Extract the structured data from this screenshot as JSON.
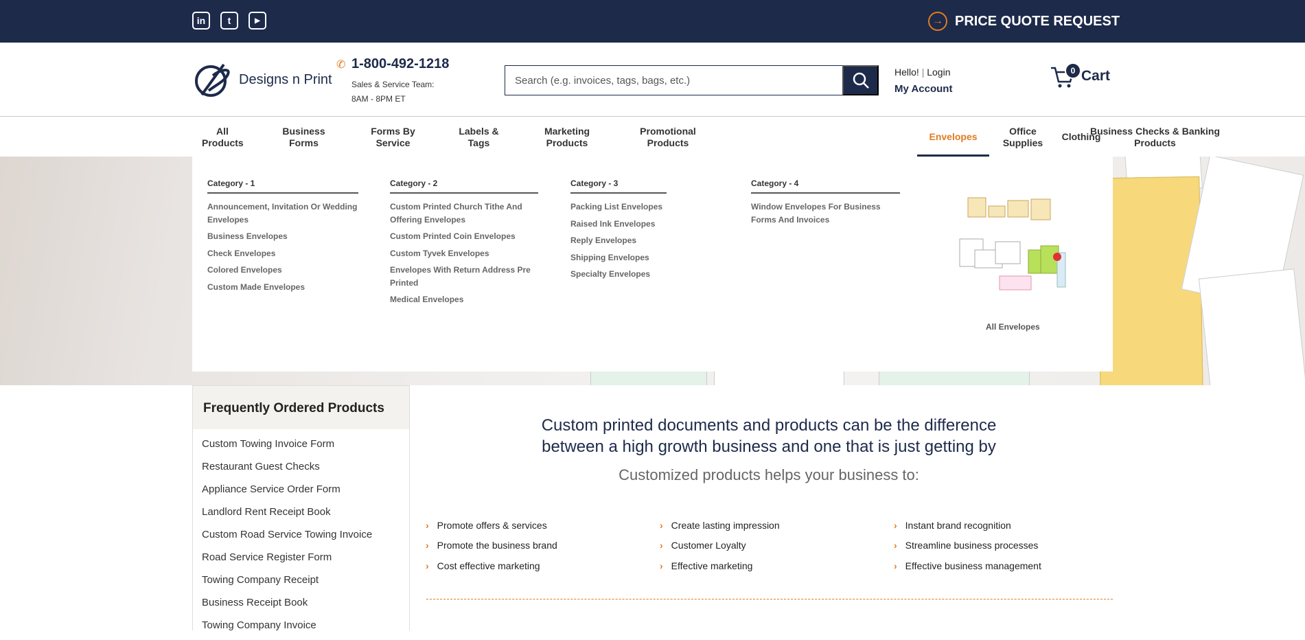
{
  "topbar": {
    "social": [
      "in",
      "t",
      "▶"
    ],
    "quote_label": "PRICE QUOTE REQUEST"
  },
  "header": {
    "logo_text": "Designs n Print",
    "phone": "1-800-492-1218",
    "phone_line1": "Sales & Service Team:",
    "phone_line2": "8AM - 8PM ET",
    "search_placeholder": "Search (e.g. invoices, tags, bags, etc.)",
    "greeting": "Hello!",
    "login": "Login",
    "my_account": "My Account",
    "cart_count": "0",
    "cart_label": "Cart"
  },
  "nav": [
    {
      "line1": "All",
      "line2": "Products"
    },
    {
      "line1": "Business",
      "line2": "Forms"
    },
    {
      "line1": "Forms By",
      "line2": "Service"
    },
    {
      "line1": "Labels &",
      "line2": "Tags"
    },
    {
      "line1": "Marketing",
      "line2": "Products"
    },
    {
      "line1": "Promotional",
      "line2": "Products"
    },
    {
      "line1": "Envelopes",
      "line2": ""
    },
    {
      "line1": "Office",
      "line2": "Supplies"
    },
    {
      "line1": "Business Checks & Banking",
      "line2": "Products"
    },
    {
      "line1": "Clothing",
      "line2": ""
    }
  ],
  "mega_menu": {
    "categories": [
      {
        "title": "Category - 1",
        "items": [
          "Announcement, Invitation Or Wedding Envelopes",
          "Business Envelopes",
          "Check Envelopes",
          "Colored Envelopes",
          "Custom Made Envelopes"
        ]
      },
      {
        "title": "Category - 2",
        "items": [
          "Custom Printed Church Tithe And Offering Envelopes",
          "Custom Printed Coin Envelopes",
          "Custom Tyvek Envelopes",
          "Envelopes With Return Address Pre Printed",
          "Medical Envelopes"
        ]
      },
      {
        "title": "Category - 3",
        "items": [
          "Packing List Envelopes",
          "Raised Ink Envelopes",
          "Reply Envelopes",
          "Shipping Envelopes",
          "Specialty Envelopes"
        ]
      },
      {
        "title": "Category - 4",
        "items": [
          "Window Envelopes For Business Forms And Invoices"
        ]
      }
    ],
    "all_link": "All Envelopes"
  },
  "sidebar": {
    "title": "Frequently Ordered Products",
    "items": [
      "Custom Towing Invoice Form",
      "Restaurant Guest Checks",
      "Appliance Service Order Form",
      "Landlord Rent Receipt Book",
      "Custom Road Service Towing Invoice",
      "Road Service Register Form",
      "Towing Company Receipt",
      "Business Receipt Book",
      "Towing Company Invoice"
    ]
  },
  "main": {
    "title_line1": "Custom printed documents and products can be the difference",
    "title_line2": "between a high growth business and one that is just getting by",
    "subtitle": "Customized products helps your business to:",
    "benefits": [
      [
        "Promote offers & services",
        "Promote the business brand",
        "Cost effective marketing"
      ],
      [
        "Create lasting impression",
        "Customer Loyalty",
        "Effective marketing"
      ],
      [
        "Instant brand recognition",
        "Streamline business processes",
        "Effective business management"
      ]
    ]
  },
  "colors": {
    "navy": "#1d2a4a",
    "accent": "#e07b22"
  }
}
